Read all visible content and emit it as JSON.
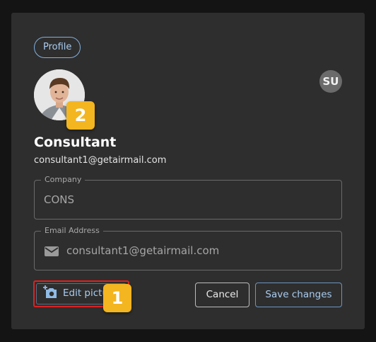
{
  "profile_chip": "Profile",
  "user_avatar_initials": "SU",
  "user": {
    "name": "Consultant",
    "email": "consultant1@getairmail.com"
  },
  "company_field": {
    "label": "Company",
    "value": "CONS"
  },
  "email_field": {
    "label": "Email Address",
    "value": "consultant1@getairmail.com",
    "icon": "mail-icon"
  },
  "buttons": {
    "edit_picture": "Edit picture",
    "cancel": "Cancel",
    "save": "Save changes"
  },
  "callouts": {
    "one": "1",
    "two": "2"
  },
  "colors": {
    "accent": "#a9ccf0",
    "highlight": "#dd2222",
    "badge": "#f3b520",
    "dialog": "#2e2e2e"
  }
}
